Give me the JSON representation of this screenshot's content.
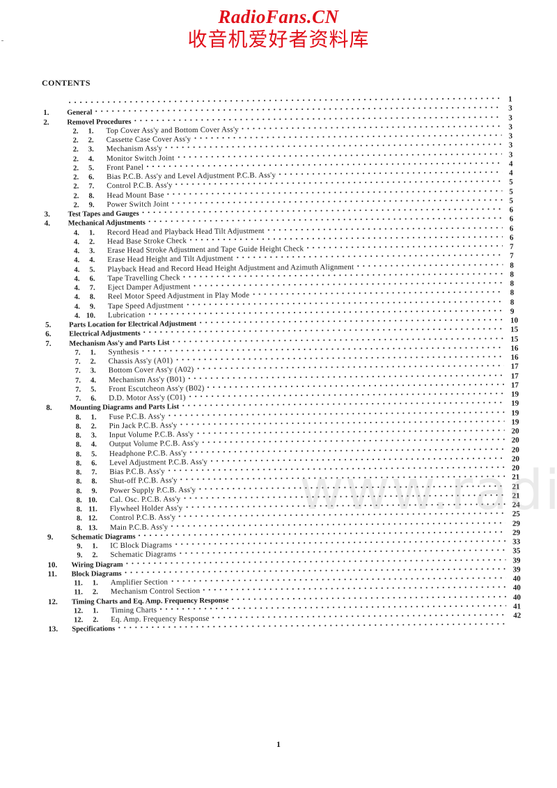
{
  "header": {
    "brand": "RadioFans.CN",
    "brand_cn": "收音机爱好者资料库"
  },
  "watermark": "www.radiofans.c",
  "contents_title": "CONTENTS",
  "toc_first_page": "1",
  "toc": [
    {
      "num": "1.",
      "label": "General",
      "page": "3",
      "children": []
    },
    {
      "num": "2.",
      "label": "Removel Procedures",
      "page": "3",
      "children": [
        {
          "a": "2.",
          "b": "1.",
          "label": "Top Cover Ass'y and Bottom Cover Ass'y",
          "page": "3"
        },
        {
          "a": "2.",
          "b": "2.",
          "label": "Cassette Case Cover Ass'y",
          "page": "3"
        },
        {
          "a": "2.",
          "b": "3.",
          "label": "Mechanism Ass'y",
          "page": "3"
        },
        {
          "a": "2.",
          "b": "4.",
          "label": "Monitor Switch Joint",
          "page": "3"
        },
        {
          "a": "2.",
          "b": "5.",
          "label": "Front Panel",
          "page": "4"
        },
        {
          "a": "2.",
          "b": "6.",
          "label": "Bias P.C.B. Ass'y and Level Adjustment P.C.B. Ass'y",
          "page": "4"
        },
        {
          "a": "2.",
          "b": "7.",
          "label": "Control P.C.B. Ass'y",
          "page": "5"
        },
        {
          "a": "2.",
          "b": "8.",
          "label": "Head Mount Base",
          "page": "5"
        },
        {
          "a": "2.",
          "b": "9.",
          "label": "Power Switch Joint",
          "page": "5"
        }
      ]
    },
    {
      "num": "3.",
      "label": "Test Tapes and Gauges",
      "page": "6",
      "children": []
    },
    {
      "num": "4.",
      "label": "Mechanical Adjustments",
      "page": "6",
      "children": [
        {
          "a": "4.",
          "b": "1.",
          "label": "Record Head and Playback Head Tilt Adjustment",
          "page": "6"
        },
        {
          "a": "4.",
          "b": "2.",
          "label": "Head Base Stroke Check",
          "page": "6"
        },
        {
          "a": "4.",
          "b": "3.",
          "label": "Erase Head Stroke Adjustment and Tape Guide Height Check",
          "page": "7"
        },
        {
          "a": "4.",
          "b": "4.",
          "label": "Erase Head Height and Tilt Adjustment",
          "page": "7"
        },
        {
          "a": "4.",
          "b": "5.",
          "label": "Playback Head and Record Head Height Adjustment and Azimuth Alignment",
          "page": "8"
        },
        {
          "a": "4.",
          "b": "6.",
          "label": "Tape Travelling Check",
          "page": "8"
        },
        {
          "a": "4.",
          "b": "7.",
          "label": "Eject Damper Adjustment",
          "page": "8"
        },
        {
          "a": "4.",
          "b": "8.",
          "label": "Reel Motor Speed Adjustment in Play Mode",
          "page": "8"
        },
        {
          "a": "4.",
          "b": "9.",
          "label": "Tape Speed Adjustment",
          "page": "8"
        },
        {
          "a": "4.",
          "b": "10.",
          "label": "Lubrication",
          "page": "9"
        }
      ]
    },
    {
      "num": "5.",
      "label": "Parts Location for Electrical Adjustment",
      "page": "10",
      "children": []
    },
    {
      "num": "6.",
      "label": "Electrical Adjustments",
      "page": "15",
      "children": []
    },
    {
      "num": "7.",
      "label": "Mechanism Ass'y and Parts List",
      "page": "15",
      "children": [
        {
          "a": "7.",
          "b": "1.",
          "label": "Synthesis",
          "page": "16"
        },
        {
          "a": "7.",
          "b": "2.",
          "label": "Chassis Ass'y (A01)",
          "page": "16"
        },
        {
          "a": "7.",
          "b": "3.",
          "label": "Bottom Cover Ass'y (A02)",
          "page": "17"
        },
        {
          "a": "7.",
          "b": "4.",
          "label": "Mechanism Ass'y (B01)",
          "page": "17"
        },
        {
          "a": "7.",
          "b": "5.",
          "label": "Front Escutcheon Ass'y (B02)",
          "page": "17"
        },
        {
          "a": "7.",
          "b": "6.",
          "label": "D.D. Motor Ass'y (C01)",
          "page": "19"
        }
      ]
    },
    {
      "num": "8.",
      "label": "Mounting Diagrams and Parts List",
      "page": "19",
      "children": [
        {
          "a": "8.",
          "b": "1.",
          "label": "Fuse P.C.B. Ass'y",
          "page": "19"
        },
        {
          "a": "8.",
          "b": "2.",
          "label": "Pin Jack P.C.B. Ass'y",
          "page": "19"
        },
        {
          "a": "8.",
          "b": "3.",
          "label": "Input Volume P.C.B. Ass'y",
          "page": "20"
        },
        {
          "a": "8.",
          "b": "4.",
          "label": "Output Volume P.C.B. Ass'y",
          "page": "20"
        },
        {
          "a": "8.",
          "b": "5.",
          "label": "Headphone P.C.B. Ass'y",
          "page": "20"
        },
        {
          "a": "8.",
          "b": "6.",
          "label": "Level Adjustment P.C.B. Ass'y",
          "page": "20"
        },
        {
          "a": "8.",
          "b": "7.",
          "label": "Bias P.C.B. Ass'y",
          "page": "20"
        },
        {
          "a": "8.",
          "b": "8.",
          "label": "Shut-off P.C.B. Ass'y",
          "page": "21"
        },
        {
          "a": "8.",
          "b": "9.",
          "label": "Power Supply P.C.B. Ass'y",
          "page": "21"
        },
        {
          "a": "8.",
          "b": "10.",
          "label": "Cal. Osc. P.C.B. Ass'y",
          "page": "21"
        },
        {
          "a": "8.",
          "b": "11.",
          "label": "Flywheel Holder Ass'y",
          "page": "24"
        },
        {
          "a": "8.",
          "b": "12.",
          "label": "Control P.C.B. Ass'y",
          "page": "25"
        },
        {
          "a": "8.",
          "b": "13.",
          "label": "Main P.C.B. Ass'y",
          "page": "29"
        }
      ]
    },
    {
      "num": "9.",
      "label": "Schematic Diagrams",
      "page": "29",
      "children": [
        {
          "a": "9.",
          "b": "1.",
          "label": "IC Block Diagrams",
          "page": "33"
        },
        {
          "a": "9.",
          "b": "2.",
          "label": "Schematic Diagrams",
          "page": "35"
        }
      ]
    },
    {
      "num": "10.",
      "label": "Wiring Diagram",
      "page": "39",
      "children": []
    },
    {
      "num": "11.",
      "label": "Block Diagrams",
      "page": "39",
      "children": [
        {
          "a": "11.",
          "b": "1.",
          "label": "Amplifier Section",
          "page": "40"
        },
        {
          "a": "11.",
          "b": "2.",
          "label": "Mechanism Control Section",
          "page": "40"
        }
      ]
    },
    {
      "num": "12.",
      "label": "Timing Charts and Eq. Amp. Frequency Response",
      "page": "40",
      "children": [
        {
          "a": "12.",
          "b": "1.",
          "label": "Timing Charts",
          "page": "41"
        },
        {
          "a": "12.",
          "b": "2.",
          "label": "Eq. Amp. Frequency Response",
          "page": "42"
        }
      ]
    },
    {
      "num": "13.",
      "label": "Specifications",
      "page": "",
      "children": []
    }
  ],
  "footer": {
    "page_number": "1"
  }
}
